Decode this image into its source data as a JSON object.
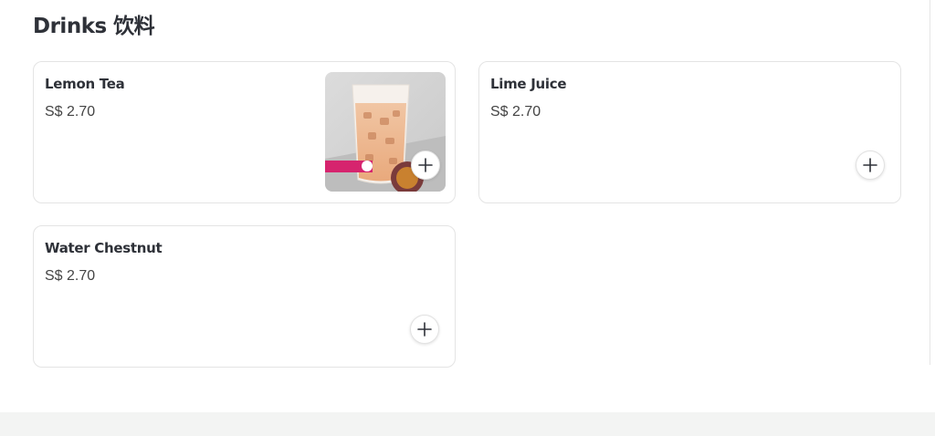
{
  "section": {
    "title": "Drinks 饮料"
  },
  "items": [
    {
      "name": "Lemon Tea",
      "price": "S$ 2.70",
      "has_image": true,
      "add_icon": "plus-icon"
    },
    {
      "name": "Lime Juice",
      "price": "S$ 2.70",
      "has_image": false,
      "add_icon": "plus-icon"
    },
    {
      "name": "Water Chestnut",
      "price": "S$ 2.70",
      "has_image": false,
      "add_icon": "plus-icon"
    }
  ],
  "colors": {
    "text": "#2e3138",
    "border": "#e4e4e4",
    "footer": "#f3f4f3",
    "brand_pink": "#d6246e"
  }
}
